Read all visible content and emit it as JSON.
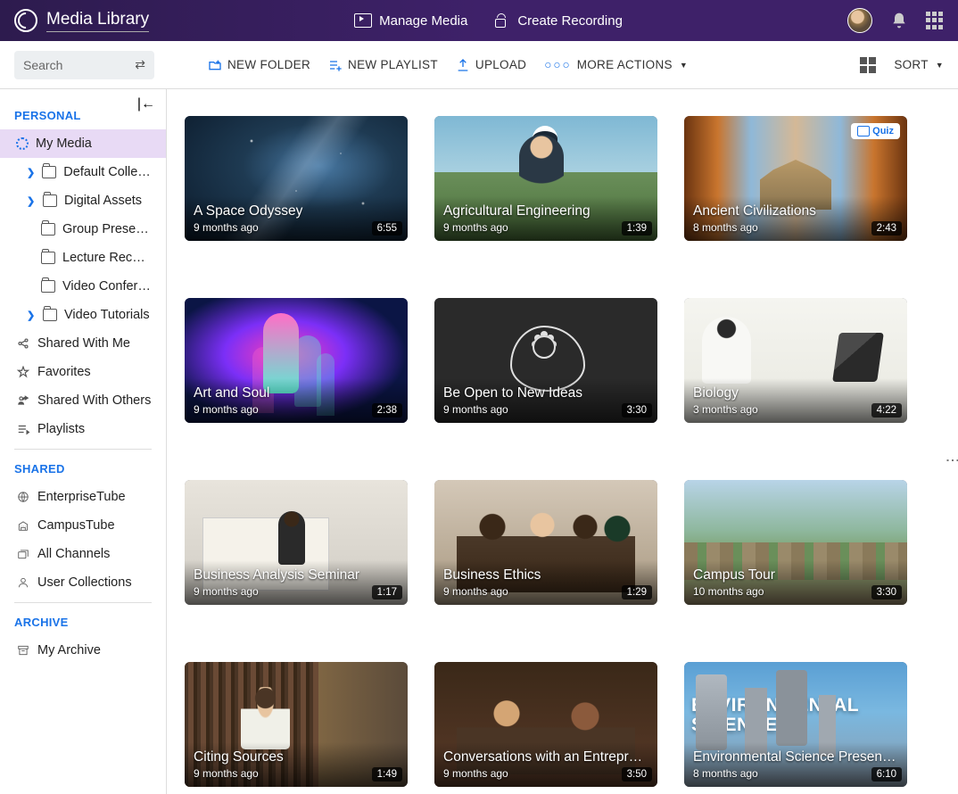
{
  "app": {
    "title": "Media Library"
  },
  "topnav": {
    "manage": "Manage Media",
    "record": "Create Recording"
  },
  "toolbar": {
    "search_placeholder": "Search",
    "new_folder": "NEW FOLDER",
    "new_playlist": "NEW PLAYLIST",
    "upload": "UPLOAD",
    "more_actions": "MORE ACTIONS",
    "sort": "SORT"
  },
  "sidebar": {
    "sections": {
      "personal": "PERSONAL",
      "shared": "SHARED",
      "archive": "ARCHIVE"
    },
    "personal": {
      "my_media": "My Media",
      "default_collection": "Default Collect...",
      "digital_assets": "Digital Assets",
      "group_present": "Group Present...",
      "lecture_recor": "Lecture Recor...",
      "video_confere": "Video Confere...",
      "video_tutorials": "Video Tutorials",
      "shared_with_me": "Shared With Me",
      "favorites": "Favorites",
      "shared_with_others": "Shared With Others",
      "playlists": "Playlists"
    },
    "shared": {
      "enterprise": "EnterpriseTube",
      "campus": "CampusTube",
      "all_channels": "All Channels",
      "user_collections": "User Collections"
    },
    "archive": {
      "my_archive": "My Archive"
    }
  },
  "cards": [
    {
      "title": "A Space Odyssey",
      "age": "9 months ago",
      "dur": "6:55"
    },
    {
      "title": "Agricultural Engineering",
      "age": "9 months ago",
      "dur": "1:39"
    },
    {
      "title": "Ancient Civilizations",
      "age": "8 months ago",
      "dur": "2:43",
      "badge": "Quiz"
    },
    {
      "title": "Art and Soul",
      "age": "9 months ago",
      "dur": "2:38"
    },
    {
      "title": "Be Open to New Ideas",
      "age": "9 months ago",
      "dur": "3:30"
    },
    {
      "title": "Biology",
      "age": "3 months ago",
      "dur": "4:22"
    },
    {
      "title": "Business Analysis Seminar",
      "age": "9 months ago",
      "dur": "1:17"
    },
    {
      "title": "Business Ethics",
      "age": "9 months ago",
      "dur": "1:29"
    },
    {
      "title": "Campus Tour",
      "age": "10 months ago",
      "dur": "3:30"
    },
    {
      "title": "Citing Sources",
      "age": "9 months ago",
      "dur": "1:49"
    },
    {
      "title": "Conversations with an Entrepren...",
      "age": "9 months ago",
      "dur": "3:50"
    },
    {
      "title": "Environmental Science Presentat...",
      "age": "8 months ago",
      "dur": "6:10"
    }
  ]
}
